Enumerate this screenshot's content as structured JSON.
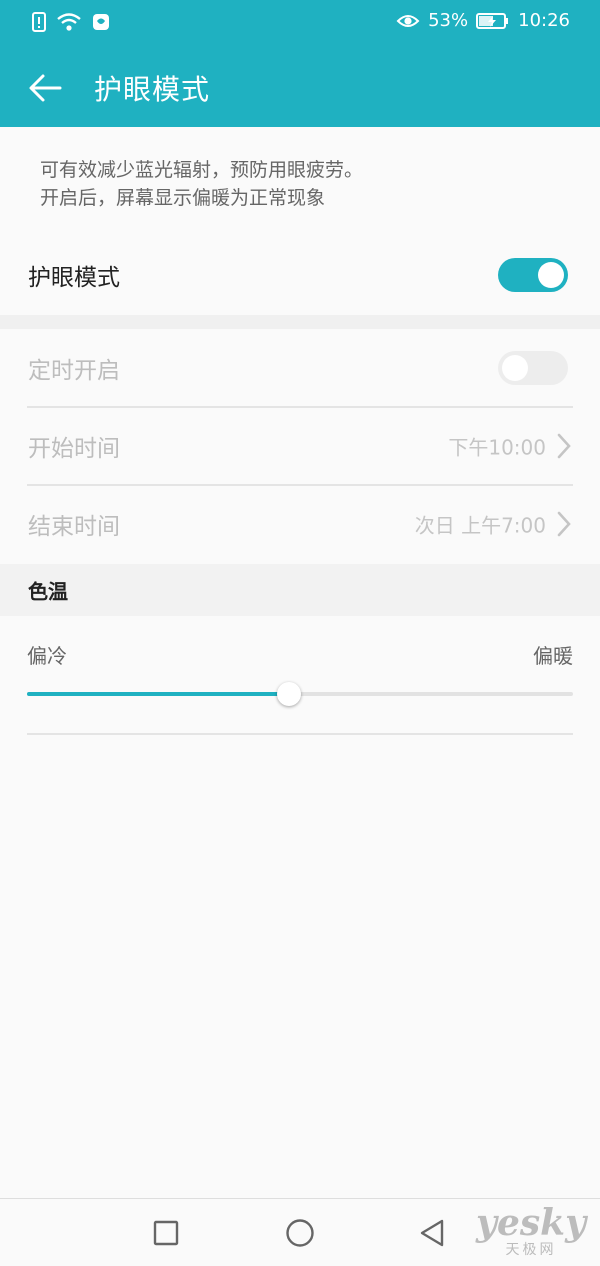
{
  "status": {
    "battery_percent": "53%",
    "time": "10:26",
    "icons": [
      "sim-alert-icon",
      "wifi-icon",
      "app-shield-icon",
      "eye-icon",
      "battery-charging-icon"
    ]
  },
  "app": {
    "title": "护眼模式",
    "back_icon": "arrow-left-icon",
    "accent_color": "#1fb1c1"
  },
  "description": {
    "line1": "可有效减少蓝光辐射，预防用眼疲劳。",
    "line2": "开启后，屏幕显示偏暖为正常现象"
  },
  "eye_mode": {
    "label": "护眼模式",
    "enabled": true
  },
  "schedule": {
    "label": "定时开启",
    "enabled": false,
    "start": {
      "label": "开始时间",
      "value": "下午10:00"
    },
    "end": {
      "label": "结束时间",
      "value": "次日 上午7:00"
    }
  },
  "color_temp": {
    "title": "色温",
    "min_label": "偏冷",
    "max_label": "偏暖",
    "level": 0.48
  },
  "navbar": {
    "icons": [
      "recents-square-icon",
      "home-circle-icon",
      "back-triangle-icon"
    ]
  },
  "watermark": {
    "logo": "yesky",
    "sub": "天极网"
  }
}
